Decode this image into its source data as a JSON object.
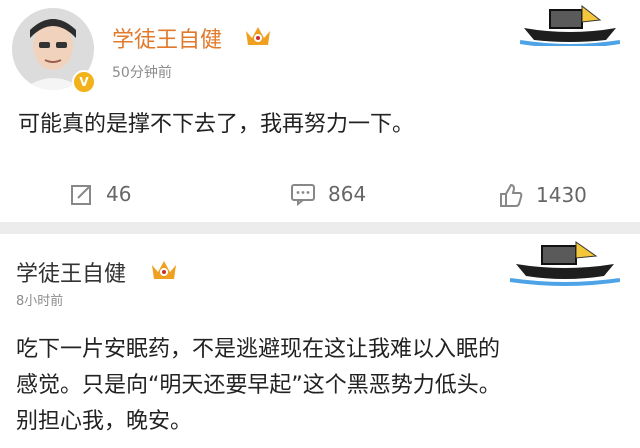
{
  "post1": {
    "author": "学徒王自健",
    "time": "50分钟前",
    "content": "可能真的是撑不下去了，我再努力一下。",
    "actions": {
      "repost_count": "46",
      "comment_count": "864",
      "like_count": "1430"
    },
    "verified_mark": "V"
  },
  "post2": {
    "author": "学徒王自健",
    "time": "8小时前",
    "content_lines": [
      "吃下一片安眠药，不是逃避现在这让我难以入眠的",
      "感觉。只是向“明天还要早起”这个黑恶势力低头。",
      "别担心我，晚安。"
    ]
  },
  "icons": [
    "crown-badge-icon",
    "boat-icon",
    "repost-icon",
    "comment-icon",
    "like-icon",
    "verified-icon"
  ],
  "colors": {
    "author_name": "#e27a2c",
    "crown": "#f0a020",
    "separator": "#ececec"
  }
}
